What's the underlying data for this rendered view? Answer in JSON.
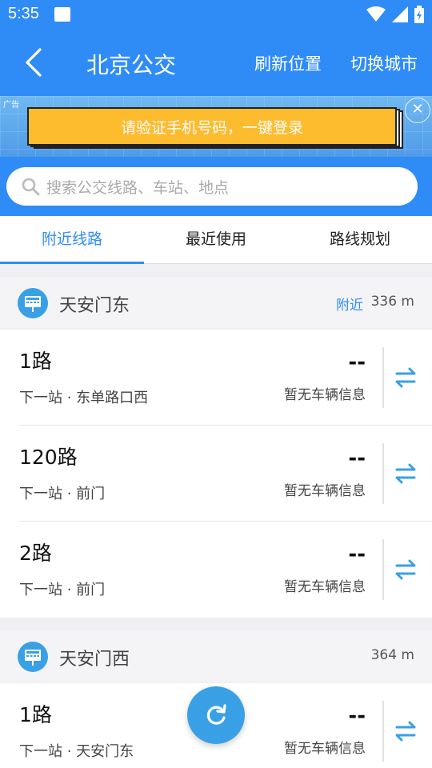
{
  "status_bar": {
    "time": "5:35",
    "icons": [
      "image-icon",
      "wifi-icon",
      "signal-icon",
      "battery-charging-icon"
    ]
  },
  "app_bar": {
    "title": "北京公交",
    "refresh_label": "刷新位置",
    "switch_city_label": "切换城市",
    "icons": [
      "back-arrow-icon"
    ]
  },
  "ad_banner": {
    "tag": "广告",
    "text": "请验证手机号码，一键登录",
    "colors": {
      "button": "#fdbb2e",
      "background": "#5aa6ec"
    },
    "icons": [
      "close-icon"
    ]
  },
  "search": {
    "placeholder": "搜索公交线路、车站、地点",
    "icons": [
      "search-icon"
    ]
  },
  "tabs": [
    {
      "label": "附近线路",
      "active": true
    },
    {
      "label": "最近使用",
      "active": false
    },
    {
      "label": "路线规划",
      "active": false
    }
  ],
  "stations": [
    {
      "name": "天安门东",
      "nearby": "附近",
      "distance": "336 m",
      "routes": [
        {
          "name": "1路",
          "next_stop": "下一站 · 东单路口西",
          "eta": "--",
          "info": "暂无车辆信息"
        },
        {
          "name": "120路",
          "next_stop": "下一站 · 前门",
          "eta": "--",
          "info": "暂无车辆信息"
        },
        {
          "name": "2路",
          "next_stop": "下一站 · 前门",
          "eta": "--",
          "info": "暂无车辆信息"
        }
      ]
    },
    {
      "name": "天安门西",
      "distance": "364 m",
      "routes": [
        {
          "name": "1路",
          "next_stop": "下一站 · 天安门东",
          "eta": "--",
          "info": "暂无车辆信息"
        }
      ]
    }
  ],
  "fab": {
    "icon": "refresh-icon"
  },
  "colors": {
    "primary": "#2f8cf7",
    "fab": "#3aa0e6",
    "station_icon": "#3aa0e6"
  }
}
